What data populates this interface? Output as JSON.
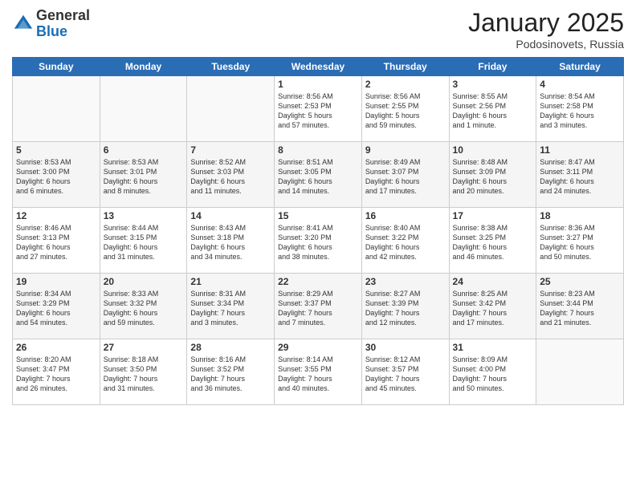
{
  "logo": {
    "general": "General",
    "blue": "Blue"
  },
  "title": "January 2025",
  "location": "Podosinovets, Russia",
  "days_of_week": [
    "Sunday",
    "Monday",
    "Tuesday",
    "Wednesday",
    "Thursday",
    "Friday",
    "Saturday"
  ],
  "weeks": [
    [
      {
        "day": "",
        "info": ""
      },
      {
        "day": "",
        "info": ""
      },
      {
        "day": "",
        "info": ""
      },
      {
        "day": "1",
        "info": "Sunrise: 8:56 AM\nSunset: 2:53 PM\nDaylight: 5 hours\nand 57 minutes."
      },
      {
        "day": "2",
        "info": "Sunrise: 8:56 AM\nSunset: 2:55 PM\nDaylight: 5 hours\nand 59 minutes."
      },
      {
        "day": "3",
        "info": "Sunrise: 8:55 AM\nSunset: 2:56 PM\nDaylight: 6 hours\nand 1 minute."
      },
      {
        "day": "4",
        "info": "Sunrise: 8:54 AM\nSunset: 2:58 PM\nDaylight: 6 hours\nand 3 minutes."
      }
    ],
    [
      {
        "day": "5",
        "info": "Sunrise: 8:53 AM\nSunset: 3:00 PM\nDaylight: 6 hours\nand 6 minutes."
      },
      {
        "day": "6",
        "info": "Sunrise: 8:53 AM\nSunset: 3:01 PM\nDaylight: 6 hours\nand 8 minutes."
      },
      {
        "day": "7",
        "info": "Sunrise: 8:52 AM\nSunset: 3:03 PM\nDaylight: 6 hours\nand 11 minutes."
      },
      {
        "day": "8",
        "info": "Sunrise: 8:51 AM\nSunset: 3:05 PM\nDaylight: 6 hours\nand 14 minutes."
      },
      {
        "day": "9",
        "info": "Sunrise: 8:49 AM\nSunset: 3:07 PM\nDaylight: 6 hours\nand 17 minutes."
      },
      {
        "day": "10",
        "info": "Sunrise: 8:48 AM\nSunset: 3:09 PM\nDaylight: 6 hours\nand 20 minutes."
      },
      {
        "day": "11",
        "info": "Sunrise: 8:47 AM\nSunset: 3:11 PM\nDaylight: 6 hours\nand 24 minutes."
      }
    ],
    [
      {
        "day": "12",
        "info": "Sunrise: 8:46 AM\nSunset: 3:13 PM\nDaylight: 6 hours\nand 27 minutes."
      },
      {
        "day": "13",
        "info": "Sunrise: 8:44 AM\nSunset: 3:15 PM\nDaylight: 6 hours\nand 31 minutes."
      },
      {
        "day": "14",
        "info": "Sunrise: 8:43 AM\nSunset: 3:18 PM\nDaylight: 6 hours\nand 34 minutes."
      },
      {
        "day": "15",
        "info": "Sunrise: 8:41 AM\nSunset: 3:20 PM\nDaylight: 6 hours\nand 38 minutes."
      },
      {
        "day": "16",
        "info": "Sunrise: 8:40 AM\nSunset: 3:22 PM\nDaylight: 6 hours\nand 42 minutes."
      },
      {
        "day": "17",
        "info": "Sunrise: 8:38 AM\nSunset: 3:25 PM\nDaylight: 6 hours\nand 46 minutes."
      },
      {
        "day": "18",
        "info": "Sunrise: 8:36 AM\nSunset: 3:27 PM\nDaylight: 6 hours\nand 50 minutes."
      }
    ],
    [
      {
        "day": "19",
        "info": "Sunrise: 8:34 AM\nSunset: 3:29 PM\nDaylight: 6 hours\nand 54 minutes."
      },
      {
        "day": "20",
        "info": "Sunrise: 8:33 AM\nSunset: 3:32 PM\nDaylight: 6 hours\nand 59 minutes."
      },
      {
        "day": "21",
        "info": "Sunrise: 8:31 AM\nSunset: 3:34 PM\nDaylight: 7 hours\nand 3 minutes."
      },
      {
        "day": "22",
        "info": "Sunrise: 8:29 AM\nSunset: 3:37 PM\nDaylight: 7 hours\nand 7 minutes."
      },
      {
        "day": "23",
        "info": "Sunrise: 8:27 AM\nSunset: 3:39 PM\nDaylight: 7 hours\nand 12 minutes."
      },
      {
        "day": "24",
        "info": "Sunrise: 8:25 AM\nSunset: 3:42 PM\nDaylight: 7 hours\nand 17 minutes."
      },
      {
        "day": "25",
        "info": "Sunrise: 8:23 AM\nSunset: 3:44 PM\nDaylight: 7 hours\nand 21 minutes."
      }
    ],
    [
      {
        "day": "26",
        "info": "Sunrise: 8:20 AM\nSunset: 3:47 PM\nDaylight: 7 hours\nand 26 minutes."
      },
      {
        "day": "27",
        "info": "Sunrise: 8:18 AM\nSunset: 3:50 PM\nDaylight: 7 hours\nand 31 minutes."
      },
      {
        "day": "28",
        "info": "Sunrise: 8:16 AM\nSunset: 3:52 PM\nDaylight: 7 hours\nand 36 minutes."
      },
      {
        "day": "29",
        "info": "Sunrise: 8:14 AM\nSunset: 3:55 PM\nDaylight: 7 hours\nand 40 minutes."
      },
      {
        "day": "30",
        "info": "Sunrise: 8:12 AM\nSunset: 3:57 PM\nDaylight: 7 hours\nand 45 minutes."
      },
      {
        "day": "31",
        "info": "Sunrise: 8:09 AM\nSunset: 4:00 PM\nDaylight: 7 hours\nand 50 minutes."
      },
      {
        "day": "",
        "info": ""
      }
    ]
  ],
  "row_shading": [
    false,
    true,
    false,
    true,
    false
  ]
}
